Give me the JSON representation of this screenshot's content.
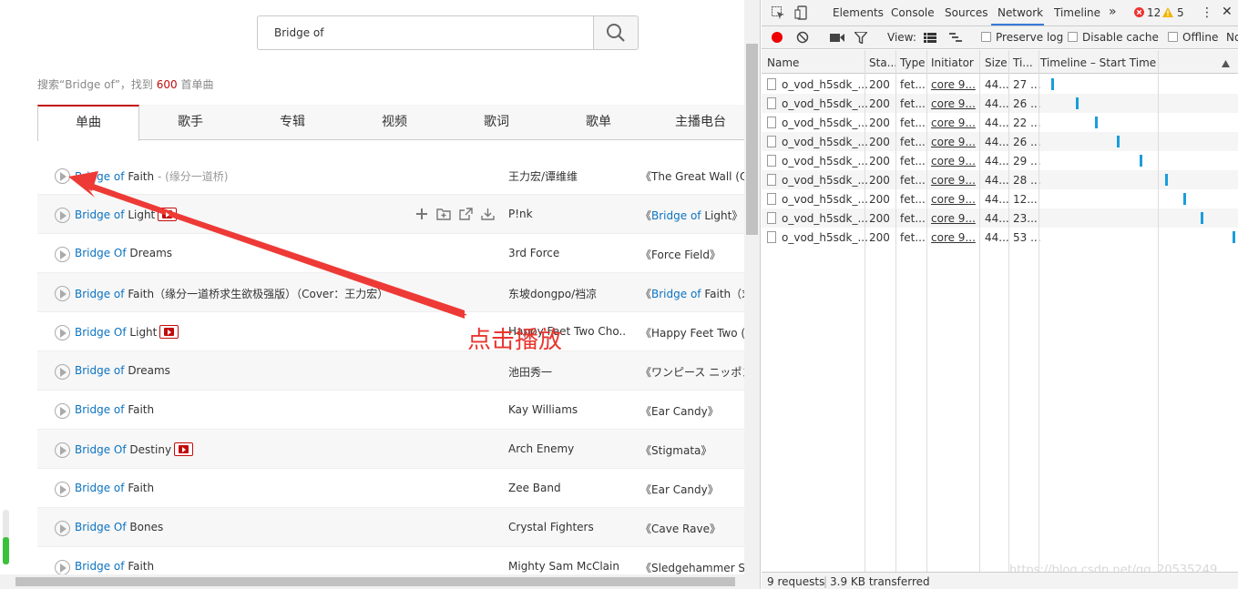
{
  "search": {
    "value": "Bridge of"
  },
  "result_info": {
    "prefix": "搜索“Bridge of”，找到 ",
    "count": "600",
    "suffix": " 首单曲"
  },
  "tabs": [
    "单曲",
    "歌手",
    "专辑",
    "视频",
    "歌词",
    "歌单",
    "主播电台"
  ],
  "songs": [
    {
      "hl": "Bridge of",
      "rest": " Faith",
      "sub": " - (缘分一道桥)",
      "mv": false,
      "artist": "王力宏/谭维维",
      "album_pre": "《",
      "album_hl": "",
      "album_rest": "The Great Wall (Ori"
    },
    {
      "hl": "Bridge of",
      "rest": " Light",
      "sub": "",
      "mv": true,
      "artist": "P!nk",
      "album_pre": "《",
      "album_hl": "Bridge of",
      "album_rest": " Light》"
    },
    {
      "hl": "Bridge Of",
      "rest": " Dreams",
      "sub": "",
      "mv": false,
      "artist": "3rd Force",
      "album_pre": "《",
      "album_hl": "",
      "album_rest": "Force Field》"
    },
    {
      "hl": "Bridge of",
      "rest": " Faith（缘分一道桥求生欲极强版）（Cover：王力宏）",
      "sub": "",
      "mv": false,
      "artist": "东坡dongpo/裆凉",
      "album_pre": "《",
      "album_hl": "Bridge of",
      "album_rest": " Faith（求"
    },
    {
      "hl": "Bridge Of",
      "rest": " Light",
      "sub": "",
      "mv": true,
      "artist": "Happy Feet Two Cho...",
      "album_pre": "《",
      "album_hl": "",
      "album_rest": "Happy Feet Two (O"
    },
    {
      "hl": "Bridge of",
      "rest": " Dreams",
      "sub": "",
      "mv": false,
      "artist": "池田秀一",
      "album_pre": "《",
      "album_hl": "",
      "album_rest": "ワンピース ニッポン"
    },
    {
      "hl": "Bridge of",
      "rest": " Faith",
      "sub": "",
      "mv": false,
      "artist": "Kay Williams",
      "album_pre": "《",
      "album_hl": "",
      "album_rest": "Ear Candy》"
    },
    {
      "hl": "Bridge Of",
      "rest": " Destiny",
      "sub": "",
      "mv": true,
      "artist": "Arch Enemy",
      "album_pre": "《",
      "album_hl": "",
      "album_rest": "Stigmata》"
    },
    {
      "hl": "Bridge of",
      "rest": " Faith",
      "sub": "",
      "mv": false,
      "artist": "Zee Band",
      "album_pre": "《",
      "album_hl": "",
      "album_rest": "Ear Candy》"
    },
    {
      "hl": "Bridge Of",
      "rest": " Bones",
      "sub": "",
      "mv": false,
      "artist": "Crystal Fighters",
      "album_pre": "《",
      "album_hl": "",
      "album_rest": "Cave Rave》"
    },
    {
      "hl": "Bridge of",
      "rest": " Faith",
      "sub": "",
      "mv": false,
      "artist": "Mighty Sam McClain",
      "album_pre": "《",
      "album_hl": "",
      "album_rest": "Sledgehammer So"
    }
  ],
  "annotation": "点击播放",
  "devtools": {
    "tabs": [
      "Elements",
      "Console",
      "Sources",
      "Network",
      "Timeline"
    ],
    "active_tab": "Network",
    "more": "»",
    "errors": "12",
    "warnings": "5",
    "toolbar": {
      "view": "View:",
      "preserve_log": "Preserve log",
      "disable_cache": "Disable cache",
      "offline": "Offline",
      "throttle": "No"
    },
    "columns": [
      "Name",
      "Sta...",
      "Type",
      "Initiator",
      "Size",
      "Ti...",
      "Timeline – Start Time"
    ],
    "requests": [
      {
        "name": "o_vod_h5sdk_...",
        "status": "200",
        "type": "fet...",
        "initiator": "core 9...",
        "size": "44...",
        "time": "27 ..."
      },
      {
        "name": "o_vod_h5sdk_...",
        "status": "200",
        "type": "fet...",
        "initiator": "core 9...",
        "size": "44...",
        "time": "26 ..."
      },
      {
        "name": "o_vod_h5sdk_...",
        "status": "200",
        "type": "fet...",
        "initiator": "core 9...",
        "size": "44...",
        "time": "22 ..."
      },
      {
        "name": "o_vod_h5sdk_...",
        "status": "200",
        "type": "fet...",
        "initiator": "core 9...",
        "size": "44...",
        "time": "26 ..."
      },
      {
        "name": "o_vod_h5sdk_...",
        "status": "200",
        "type": "fet...",
        "initiator": "core 9...",
        "size": "44...",
        "time": "29 ..."
      },
      {
        "name": "o_vod_h5sdk_...",
        "status": "200",
        "type": "fet...",
        "initiator": "core 9...",
        "size": "44...",
        "time": "28 ..."
      },
      {
        "name": "o_vod_h5sdk_...",
        "status": "200",
        "type": "fet...",
        "initiator": "core 9...",
        "size": "44...",
        "time": "12..."
      },
      {
        "name": "o_vod_h5sdk_...",
        "status": "200",
        "type": "fet...",
        "initiator": "core 9...",
        "size": "44...",
        "time": "23..."
      },
      {
        "name": "o_vod_h5sdk_...",
        "status": "200",
        "type": "fet...",
        "initiator": "core 9...",
        "size": "44...",
        "time": "53 ..."
      }
    ],
    "summary_requests": "9 requests",
    "summary_transferred": "3.9 KB transferred",
    "watermark": "https://blog.csdn.net/qq_20535249"
  },
  "colors": {
    "accent": "#c20c0c",
    "link": "#0c73c2",
    "annotation": "#e8352f",
    "waterfall": "#1a9ddc"
  }
}
